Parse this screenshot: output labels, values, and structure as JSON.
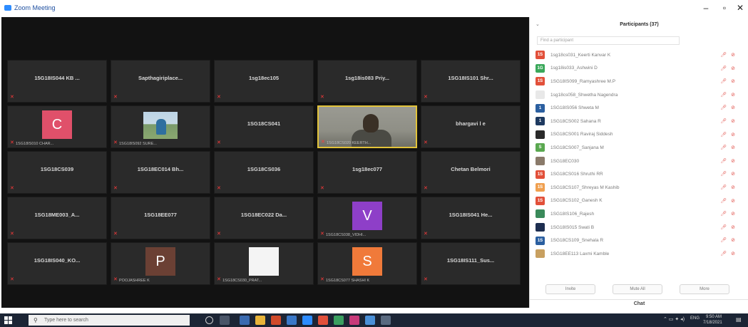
{
  "window": {
    "title": "Zoom Meeting",
    "controls": [
      "–",
      "▫",
      "✕"
    ]
  },
  "grid": {
    "tiles": [
      {
        "name": "15G18IS044 KB ...",
        "type": "text"
      },
      {
        "name": "Sapthagiriplace...",
        "type": "text"
      },
      {
        "name": "1sg18ec105",
        "type": "text"
      },
      {
        "name": "1sg18is083 Priy...",
        "type": "text"
      },
      {
        "name": "1SG18IS101 Shr...",
        "type": "text"
      },
      {
        "name": "",
        "type": "avatar",
        "letter": "C",
        "color": "#e0506a",
        "label": "1SG18IS010 CHAR..."
      },
      {
        "name": "",
        "type": "photo",
        "label": "1SG18IS092 SURE..."
      },
      {
        "name": "1SG18CS041",
        "type": "text"
      },
      {
        "name": "",
        "type": "video",
        "label": "1SG18CS020 KEERTH...",
        "active": true
      },
      {
        "name": "bhargavi l e",
        "type": "text"
      },
      {
        "name": "1SG18CS039",
        "type": "text"
      },
      {
        "name": "1SG18EC014 Bh...",
        "type": "text"
      },
      {
        "name": "1SG18CS036",
        "type": "text"
      },
      {
        "name": "1sg18ec077",
        "type": "text"
      },
      {
        "name": "Chetan Belmori",
        "type": "text"
      },
      {
        "name": "1SG18ME003_A...",
        "type": "text"
      },
      {
        "name": "1SG18EE077",
        "type": "text"
      },
      {
        "name": "1SG18EC022 Da...",
        "type": "text"
      },
      {
        "name": "",
        "type": "avatar",
        "letter": "V",
        "color": "#8e3fc8",
        "label": "1SG18CS038_VIDHI..."
      },
      {
        "name": "1SG18IS041 He...",
        "type": "text"
      },
      {
        "name": "1SG18IS040_KO...",
        "type": "text"
      },
      {
        "name": "",
        "type": "avatar",
        "letter": "P",
        "color": "#6b4034",
        "label": "POOJASHREE K"
      },
      {
        "name": "",
        "type": "blank",
        "label": "1SG18CS030_PRAT..."
      },
      {
        "name": "",
        "type": "avatar",
        "letter": "S",
        "color": "#f07a3a",
        "label": "1SG18CS077 SHASHI K"
      },
      {
        "name": "1SG18IS111_Sus...",
        "type": "text"
      }
    ]
  },
  "panel": {
    "title": "Participants (37)",
    "search_placeholder": "Find a participant",
    "participants": [
      {
        "initials": "1S",
        "color": "#e2503a",
        "name": "1sg18cs031_Keerti Kanvar K"
      },
      {
        "initials": "1G",
        "color": "#3aa85a",
        "name": "1sg18is033_Ashwini D"
      },
      {
        "initials": "1S",
        "color": "#e2503a",
        "name": "1SG18IS099_Ramyashree M.P"
      },
      {
        "initials": "",
        "color": "#e8e8e8",
        "name": "1sg18cs058_Shwetha Nagendra"
      },
      {
        "initials": "1",
        "color": "#2b5fa0",
        "name": "1SG18IS056 Shweta M"
      },
      {
        "initials": "1",
        "color": "#1e3a60",
        "name": "1SG18CS002 Sahana R"
      },
      {
        "initials": "",
        "color": "#2a2a2a",
        "name": "1SG18CS001 Raviraj Siddesh"
      },
      {
        "initials": "S",
        "color": "#5aa850",
        "name": "1SG18CS007_Sanjana M"
      },
      {
        "initials": "",
        "color": "#8a7a6a",
        "name": "1SG18EC030"
      },
      {
        "initials": "1S",
        "color": "#e2503a",
        "name": "1SG18CS016 Shruthi RR"
      },
      {
        "initials": "1S",
        "color": "#f0a050",
        "name": "1SG18CS107_Shreyas M Kashib"
      },
      {
        "initials": "1S",
        "color": "#e2503a",
        "name": "1SG18CS102_Ganesh K"
      },
      {
        "initials": "",
        "color": "#3a8a5a",
        "name": "1SG18IS106_Rajesh"
      },
      {
        "initials": "",
        "color": "#1e2e50",
        "name": "1SG18IS015 Swati B"
      },
      {
        "initials": "1S",
        "color": "#2b5fa0",
        "name": "1SG18CS109_Snehala R"
      },
      {
        "initials": "",
        "color": "#c8a060",
        "name": "1SG18EE113 Laxmi Kamble"
      }
    ],
    "actions": [
      "Invite",
      "Mute All",
      "More"
    ],
    "chat_label": "Chat"
  },
  "taskbar": {
    "search_placeholder": "Type here to search",
    "clock_time": "9:50 AM",
    "clock_date": "7/18/2021",
    "lang": "ENG"
  }
}
